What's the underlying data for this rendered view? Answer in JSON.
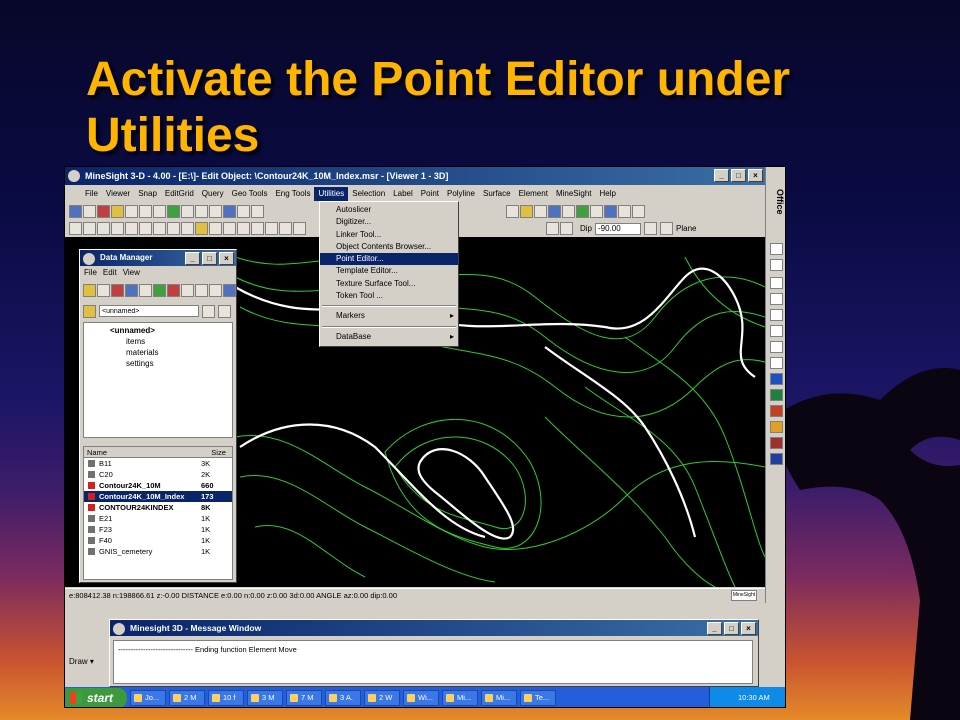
{
  "slide": {
    "title": "Activate the Point Editor under Utilities"
  },
  "app": {
    "title": "MineSight 3-D  - 4.00 - [E:\\]- Edit Object: \\Contour24K_10M_Index.msr  - [Viewer 1 - 3D]",
    "window_controls": [
      "_",
      "□",
      "×"
    ]
  },
  "menubar": [
    "File",
    "Viewer",
    "Snap",
    "EditGrid",
    "Query",
    "Geo Tools",
    "Eng Tools",
    "Utilities",
    "Selection",
    "Label",
    "Point",
    "Polyline",
    "Surface",
    "Element",
    "MineSight",
    "Help"
  ],
  "active_menu": "Utilities",
  "toolbar": {
    "dip_label": "Dip",
    "dip_value": "-90.00",
    "plane_label": "Plane"
  },
  "utilities_menu": {
    "items": [
      "Autoslicer",
      "Digitizer...",
      "Linker Tool...",
      "Object Contents Browser...",
      "Point Editor...",
      "Template Editor...",
      "Texture Surface Tool...",
      "Token Tool ..."
    ],
    "highlighted": "Point Editor...",
    "submenus": [
      "Markers",
      "DataBase"
    ],
    "submenu_arrow": "▸"
  },
  "data_manager": {
    "title": "Data Manager",
    "menu": [
      "File",
      "Edit",
      "View"
    ],
    "folder_value": "<unnamed>",
    "tree": [
      "<unnamed>",
      "items",
      "materials",
      "settings"
    ],
    "columns": [
      "Name",
      "Size"
    ],
    "rows": [
      {
        "name": "B11",
        "size": "3K"
      },
      {
        "name": "C20",
        "size": "2K"
      },
      {
        "name": "Contour24K_10M",
        "size": "660"
      },
      {
        "name": "Contour24K_10M_Index",
        "size": "173"
      },
      {
        "name": "CONTOUR24KINDEX",
        "size": "8K"
      },
      {
        "name": "E21",
        "size": "1K"
      },
      {
        "name": "F23",
        "size": "1K"
      },
      {
        "name": "F40",
        "size": "1K"
      },
      {
        "name": "GNIS_cemetery",
        "size": "1K"
      }
    ],
    "selected_row": "Contour24K_10M_Index"
  },
  "office_bar": {
    "label": "Office"
  },
  "statusbar": {
    "text": "e:808412.38  n:198866.61  z:-0.00   DISTANCE  e:0.00  n:0.00  z:0.00  3d:0.00    ANGLE  az:0.00  dip:0.00",
    "logo": "MineSight"
  },
  "lower": {
    "draw_label": "Draw ▾"
  },
  "message_window": {
    "title": "Minesight 3D - Message Window",
    "text": "------------------------------ Ending function Element Move"
  },
  "taskbar": {
    "start": "start",
    "tasks": [
      "Jo...",
      "2 M",
      "10 f",
      "3 M",
      "7 M",
      "3 A.",
      "2 W",
      "Wi...",
      "Mi...",
      "Mi...",
      "Te..."
    ],
    "clock": "10:30 AM"
  }
}
